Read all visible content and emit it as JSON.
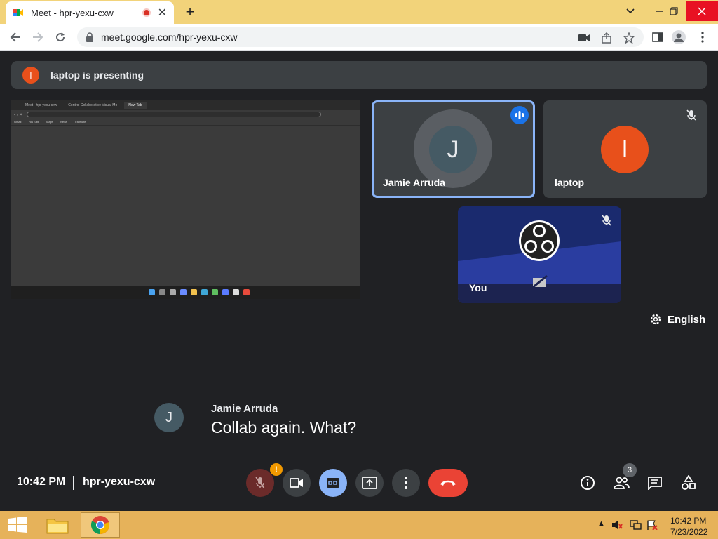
{
  "browser": {
    "tab_title": "Meet - hpr-yexu-cxw",
    "url": "meet.google.com/hpr-yexu-cxw",
    "tab_close": "✕",
    "new_tab": "+"
  },
  "meet": {
    "presenting_banner": "laptop is presenting",
    "presenter_initial": "l",
    "screen_share": {
      "tabs": [
        "Meet - hpr-yexu-cxw",
        "Control Collaborative Visual Mo",
        "New Tab"
      ],
      "bookmarks": [
        "Gmail",
        "YouTube",
        "Maps",
        "News",
        "Translate"
      ]
    },
    "participants": [
      {
        "name": "Jamie Arruda",
        "initial": "J",
        "speaking": true
      },
      {
        "name": "laptop",
        "initial": "l",
        "muted": true
      },
      {
        "name": "You",
        "muted": true,
        "camera_off": true
      }
    ],
    "language": "English",
    "caption": {
      "speaker": "Jamie Arruda",
      "initial": "J",
      "text": "Collab again. What?"
    },
    "footer": {
      "time": "10:42 PM",
      "meeting_code": "hpr-yexu-cxw",
      "participant_count": "3"
    },
    "mic_warning": "!"
  },
  "taskbar": {
    "time": "10:42 PM",
    "date": "7/23/2022"
  },
  "colors": {
    "accent_blue": "#8ab4f8",
    "end_call_red": "#ea4335",
    "presenter_orange": "#e8501b",
    "meet_bg": "#202124"
  }
}
